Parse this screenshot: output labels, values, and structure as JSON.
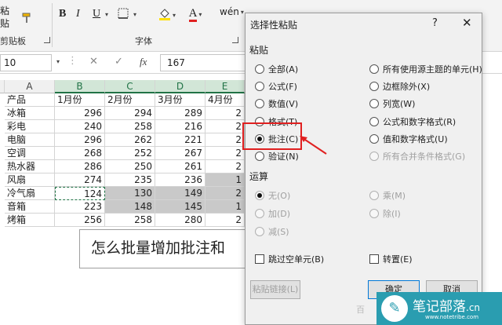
{
  "ribbon": {
    "paste_label": "粘贴",
    "clipboard_group": "剪贴板",
    "font_group": "字体",
    "bold": "B",
    "italic": "I",
    "underline": "U",
    "font_color_glyph": "A",
    "wen_glyph": "wén",
    "fill_color": "#ffe000",
    "font_color": "#e02020"
  },
  "formula_bar": {
    "name_box": "10",
    "cancel_icon": "✕",
    "enter_icon": "✓",
    "fx_icon": "fx",
    "value": "167"
  },
  "sheet": {
    "columns": [
      "A",
      "B",
      "C",
      "D",
      "E"
    ],
    "header_row": [
      "产品",
      "1月份",
      "2月份",
      "3月份",
      "4月份"
    ],
    "rows": [
      {
        "name": "冰箱",
        "v": [
          "296",
          "294",
          "289",
          "2"
        ]
      },
      {
        "name": "彩电",
        "v": [
          "240",
          "258",
          "216",
          "2"
        ]
      },
      {
        "name": "电脑",
        "v": [
          "296",
          "262",
          "221",
          "2"
        ]
      },
      {
        "name": "空调",
        "v": [
          "268",
          "252",
          "267",
          "2"
        ]
      },
      {
        "name": "热水器",
        "v": [
          "286",
          "250",
          "261",
          "2"
        ]
      },
      {
        "name": "风扇",
        "v": [
          "274",
          "235",
          "236",
          "1"
        ]
      },
      {
        "name": "冷气扇",
        "v": [
          "124",
          "130",
          "149",
          "2"
        ]
      },
      {
        "name": "音箱",
        "v": [
          "223",
          "148",
          "145",
          "1"
        ]
      },
      {
        "name": "烤箱",
        "v": [
          "256",
          "258",
          "280",
          "2"
        ]
      }
    ],
    "textbox": "怎么批量增加批注和"
  },
  "dialog": {
    "title": "选择性粘贴",
    "help": "?",
    "close": "✕",
    "paste_section": "粘贴",
    "paste_options_left": [
      {
        "label": "全部(A)",
        "selected": false
      },
      {
        "label": "公式(F)",
        "selected": false
      },
      {
        "label": "数值(V)",
        "selected": false
      },
      {
        "label": "格式(T)",
        "selected": false
      },
      {
        "label": "批注(C)",
        "selected": true
      },
      {
        "label": "验证(N)",
        "selected": false
      }
    ],
    "paste_options_right": [
      {
        "label": "所有使用源主题的单元(H)",
        "disabled": false
      },
      {
        "label": "边框除外(X)",
        "disabled": false
      },
      {
        "label": "列宽(W)",
        "disabled": false
      },
      {
        "label": "公式和数字格式(R)",
        "disabled": false
      },
      {
        "label": "值和数字格式(U)",
        "disabled": false
      },
      {
        "label": "所有合并条件格式(G)",
        "disabled": true
      }
    ],
    "operation_section": "运算",
    "operation_left": [
      "无(O)",
      "加(D)",
      "减(S)"
    ],
    "operation_right": [
      "乘(M)",
      "除(I)"
    ],
    "skip_blanks": "跳过空单元(B)",
    "transpose": "转置(E)",
    "paste_link": "粘贴链接(L)",
    "ok": "确定",
    "cancel": "取消"
  },
  "watermark": {
    "logo_glyph": "✎",
    "name": "笔记部落",
    "suffix": ".cn",
    "url": "www.notetribe.com",
    "ghost": "百"
  },
  "colors": {
    "excel_green": "#217346",
    "selected_gray": "#c9c9c9",
    "annotation_red": "#e02020",
    "watermark_teal": "#2a9db0"
  }
}
